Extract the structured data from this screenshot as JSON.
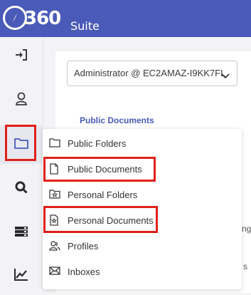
{
  "header": {
    "logo_number": "360",
    "logo_suite": "Suite",
    "logo_icon": "compass-icon",
    "brand_color": "#4a5ab8"
  },
  "sidebar": {
    "items": [
      {
        "icon": "sign-in-icon"
      },
      {
        "icon": "user-icon"
      },
      {
        "icon": "folder-icon",
        "active": true
      },
      {
        "icon": "search-icon"
      },
      {
        "icon": "server-icon"
      },
      {
        "icon": "chart-line-icon"
      }
    ]
  },
  "main": {
    "account_select": {
      "value": "Administrator @ EC2AMAZ-I9KK7FL"
    },
    "tab_title": "Public Documents",
    "fragment_1": "ng",
    "fragment_2": "s"
  },
  "menu": {
    "items": [
      {
        "label": "Public Folders",
        "icon": "folder-outline-icon"
      },
      {
        "label": "Public Documents",
        "icon": "file-outline-icon",
        "highlighted": true
      },
      {
        "label": "Personal Folders",
        "icon": "folder-star-icon"
      },
      {
        "label": "Personal Documents",
        "icon": "file-star-icon",
        "highlighted": true
      },
      {
        "label": "Profiles",
        "icon": "users-icon"
      },
      {
        "label": "Inboxes",
        "icon": "envelope-icon"
      }
    ]
  },
  "annotation_color": "#e0201b"
}
